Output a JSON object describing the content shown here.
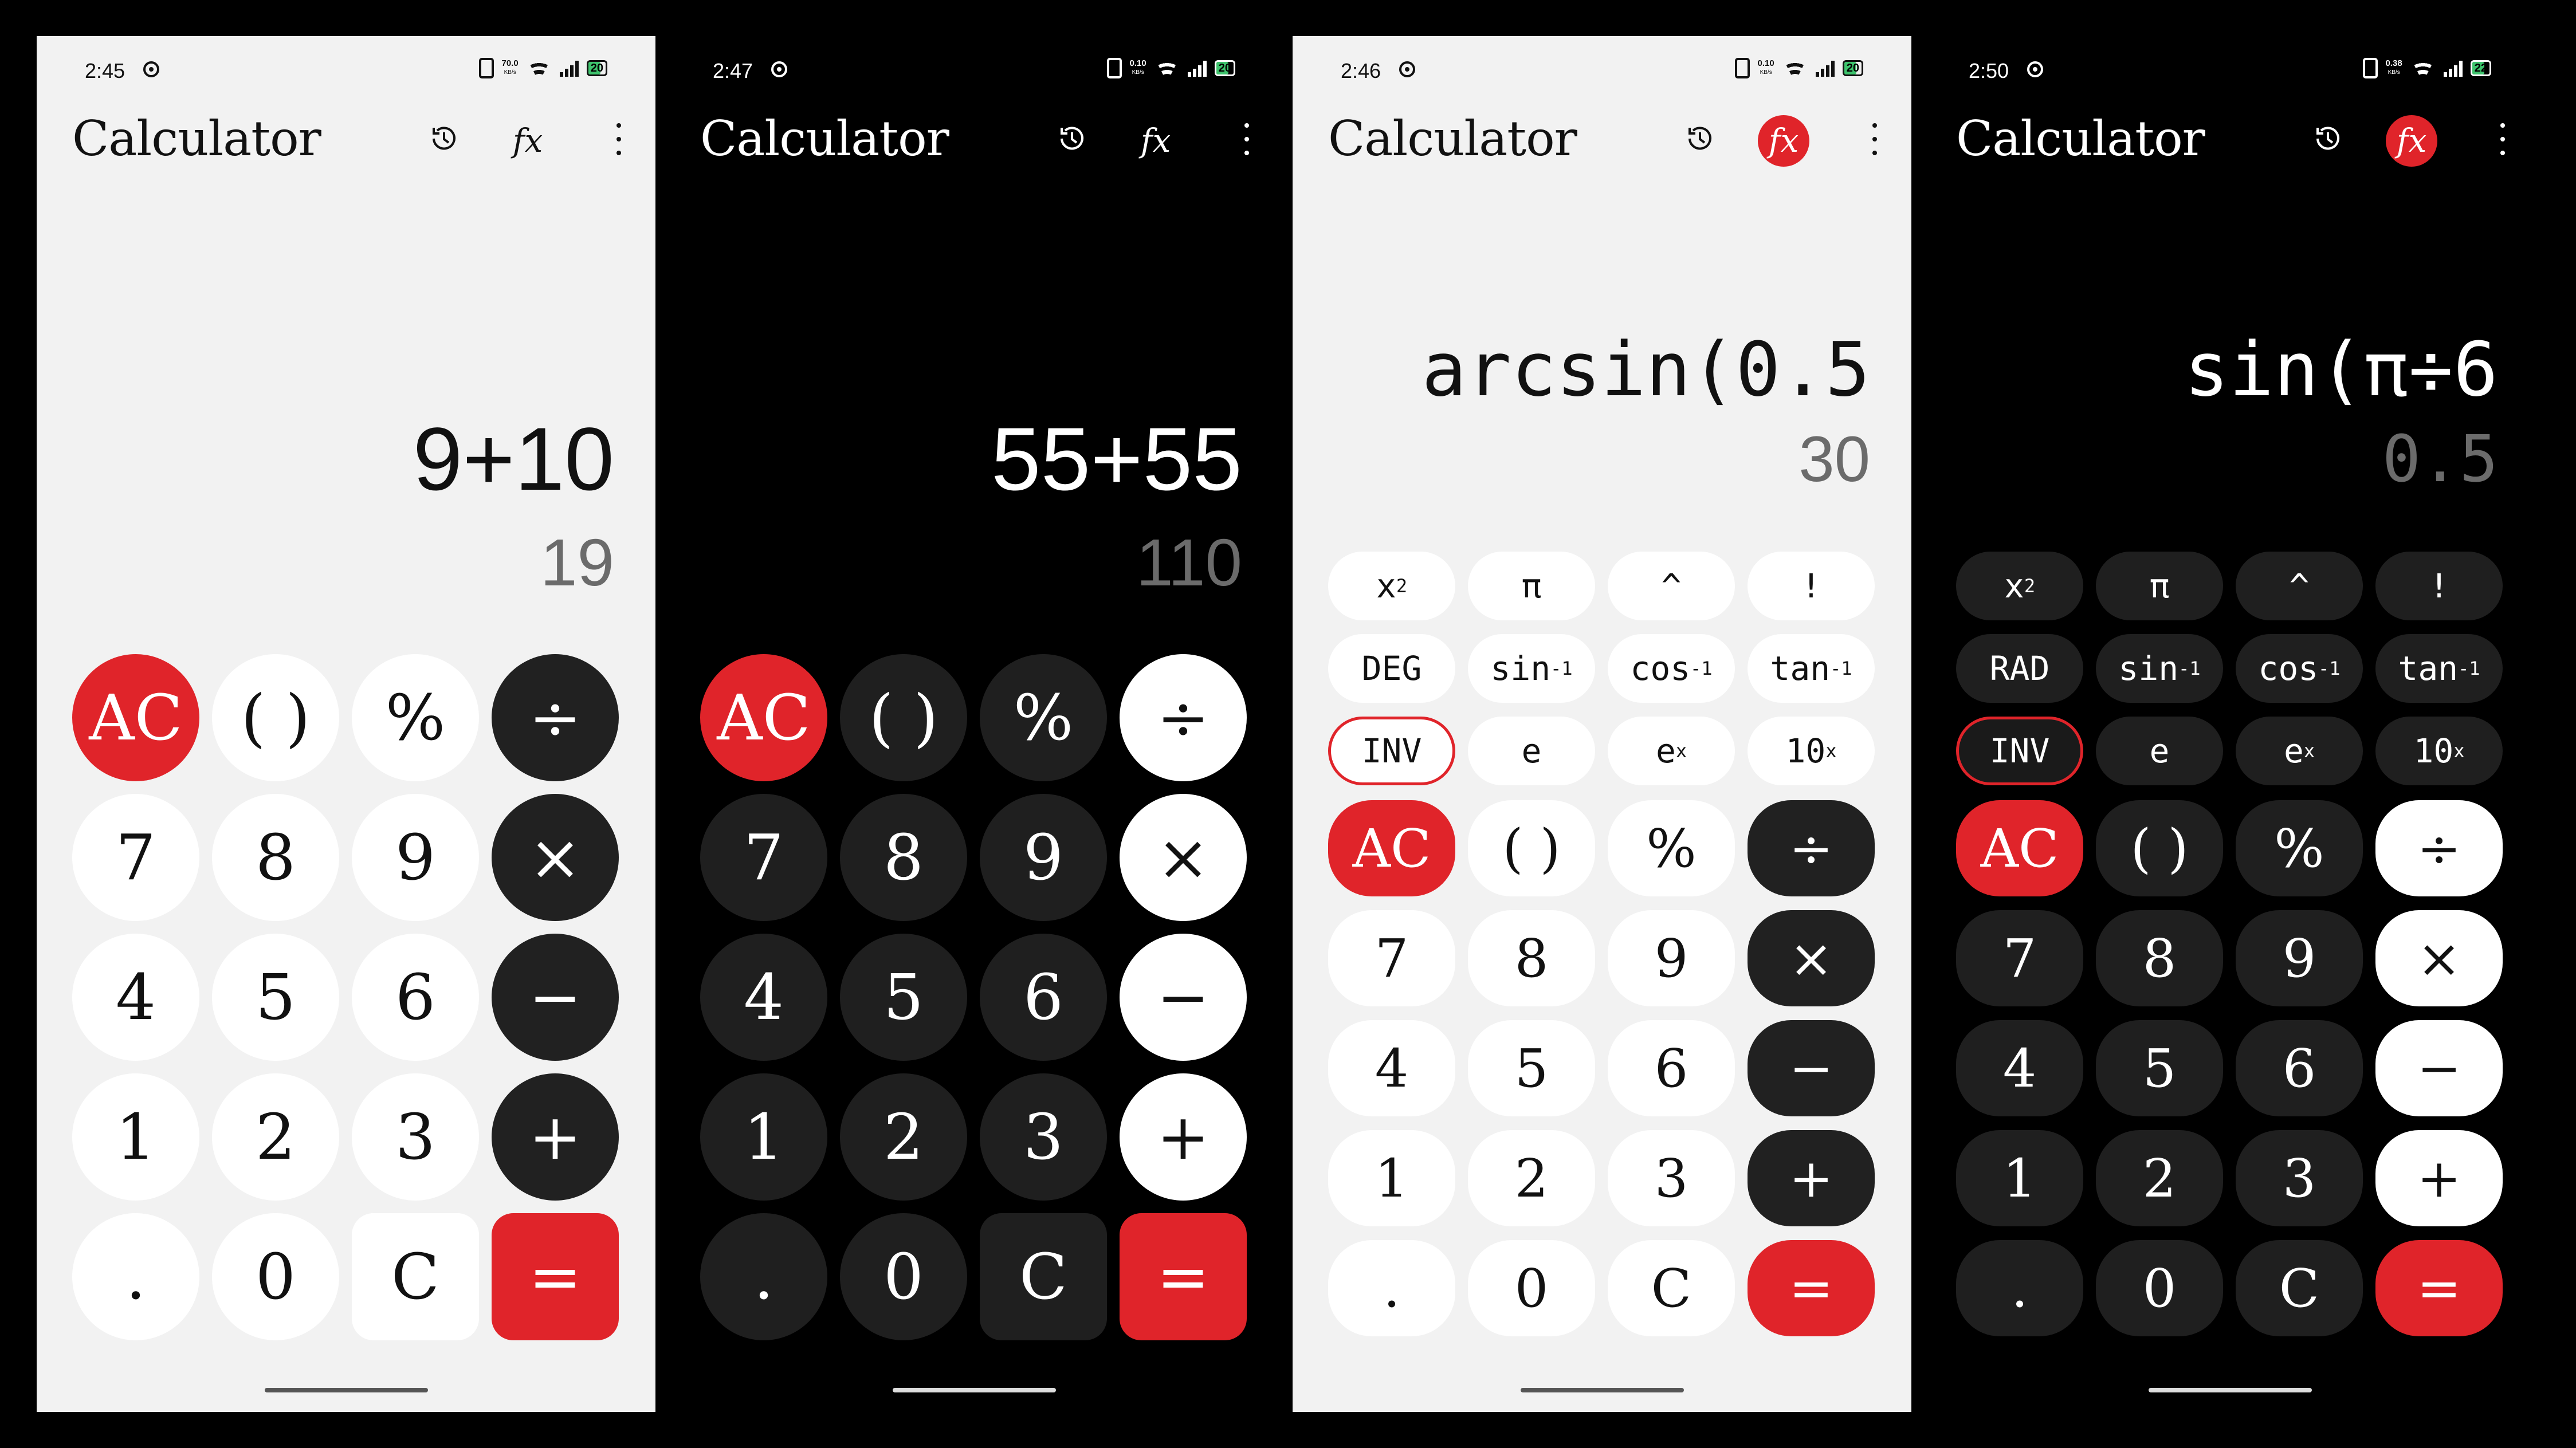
{
  "app_title": "Calculator",
  "colors": {
    "accent_red": "#e0242a",
    "dark_key": "#212121",
    "light_bg": "#f2f2f2"
  },
  "icons": {
    "history": "history-icon",
    "fx": "function-fx-icon",
    "menu": "more-vert-icon"
  },
  "fx_label": "fx",
  "keys_basic": [
    "AC",
    "( )",
    "%",
    "÷",
    "7",
    "8",
    "9",
    "×",
    "4",
    "5",
    "6",
    "−",
    "1",
    "2",
    "3",
    "+",
    ".",
    "0",
    "C",
    "="
  ],
  "keys_sci_fn": {
    "row1": [
      "x",
      "π",
      "^",
      "!"
    ],
    "row1_sup": "2",
    "row2_mid": [
      "sin",
      "cos",
      "tan"
    ],
    "row2_sup": "-1",
    "row3": [
      "INV",
      "e",
      "e",
      "10"
    ],
    "row3_sup": "x"
  },
  "screens": [
    {
      "time": "2:45",
      "speed": "70.0",
      "speed_unit": "KB/s",
      "battery": "20",
      "expression": "9+10",
      "result": "19"
    },
    {
      "time": "2:47",
      "speed": "0.10",
      "speed_unit": "KB/s",
      "battery": "20",
      "expression": "55+55",
      "result": "110"
    },
    {
      "time": "2:46",
      "speed": "0.10",
      "speed_unit": "KB/s",
      "battery": "20",
      "expression": "arcsin(0.5",
      "result": "30",
      "angle_mode": "DEG"
    },
    {
      "time": "2:50",
      "speed": "0.38",
      "speed_unit": "KB/s",
      "battery": "22",
      "expression": "sin(π÷6",
      "result": "0.5",
      "angle_mode": "RAD"
    }
  ]
}
